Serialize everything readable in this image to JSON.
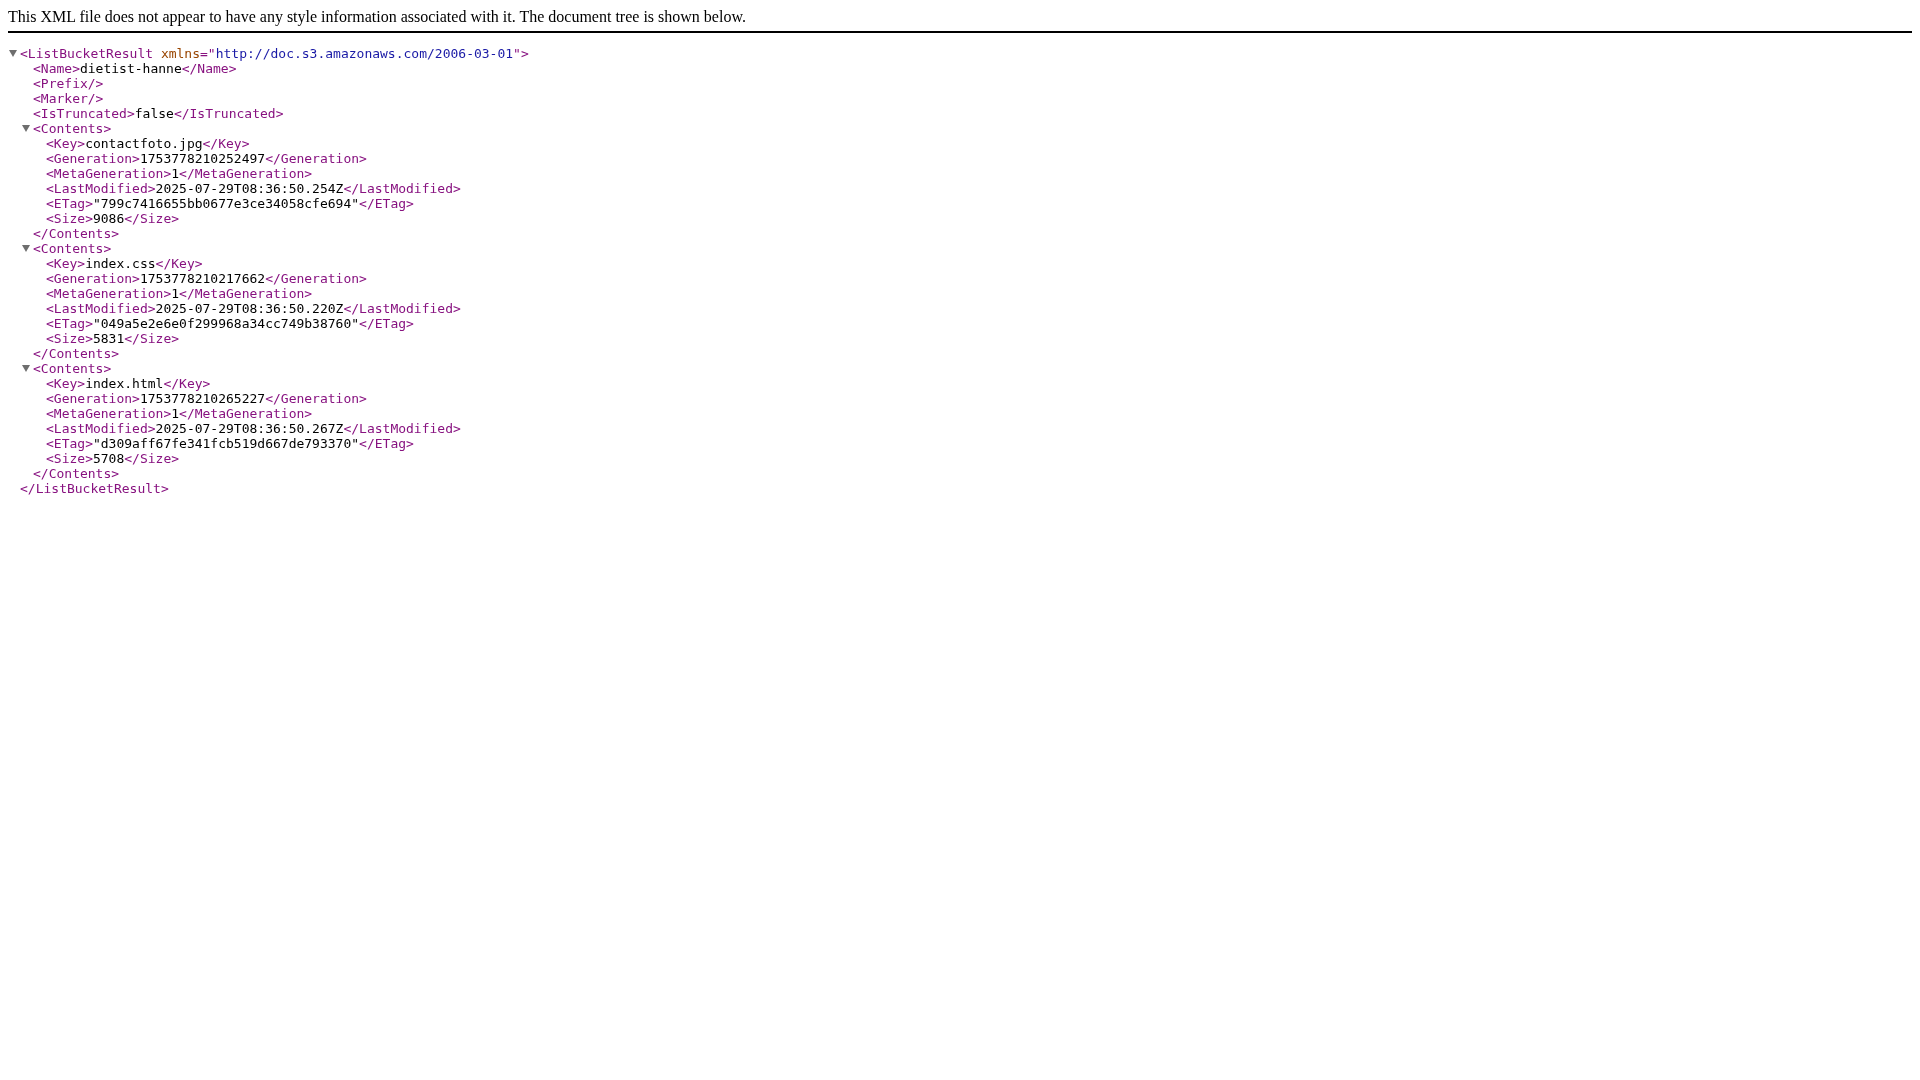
{
  "notice": "This XML file does not appear to have any style information associated with it. The document tree is shown below.",
  "root": {
    "expanded": true,
    "open": "<ListBucketResult",
    "attributes": [
      {
        "name": "xmlns",
        "equals": "=\"",
        "value": "http://doc.s3.amazonaws.com/2006-03-01",
        "quote": "\""
      }
    ],
    "open_end": ">",
    "close": "</ListBucketResult>",
    "children": [
      {
        "open": "<Name>",
        "text": "dietist-hanne",
        "close": "</Name>"
      },
      {
        "open": "<Prefix/>"
      },
      {
        "open": "<Marker/>"
      },
      {
        "open": "<IsTruncated>",
        "text": "false",
        "close": "</IsTruncated>"
      },
      {
        "expanded": true,
        "open": "<Contents>",
        "close": "</Contents>",
        "children": [
          {
            "open": "<Key>",
            "text": "contactfoto.jpg",
            "close": "</Key>"
          },
          {
            "open": "<Generation>",
            "text": "1753778210252497",
            "close": "</Generation>"
          },
          {
            "open": "<MetaGeneration>",
            "text": "1",
            "close": "</MetaGeneration>"
          },
          {
            "open": "<LastModified>",
            "text": "2025-07-29T08:36:50.254Z",
            "close": "</LastModified>"
          },
          {
            "open": "<ETag>",
            "text": "\"799c7416655bb0677e3ce34058cfe694\"",
            "close": "</ETag>"
          },
          {
            "open": "<Size>",
            "text": "9086",
            "close": "</Size>"
          }
        ]
      },
      {
        "expanded": true,
        "open": "<Contents>",
        "close": "</Contents>",
        "children": [
          {
            "open": "<Key>",
            "text": "index.css",
            "close": "</Key>"
          },
          {
            "open": "<Generation>",
            "text": "1753778210217662",
            "close": "</Generation>"
          },
          {
            "open": "<MetaGeneration>",
            "text": "1",
            "close": "</MetaGeneration>"
          },
          {
            "open": "<LastModified>",
            "text": "2025-07-29T08:36:50.220Z",
            "close": "</LastModified>"
          },
          {
            "open": "<ETag>",
            "text": "\"049a5e2e6e0f299968a34cc749b38760\"",
            "close": "</ETag>"
          },
          {
            "open": "<Size>",
            "text": "5831",
            "close": "</Size>"
          }
        ]
      },
      {
        "expanded": true,
        "open": "<Contents>",
        "close": "</Contents>",
        "children": [
          {
            "open": "<Key>",
            "text": "index.html",
            "close": "</Key>"
          },
          {
            "open": "<Generation>",
            "text": "1753778210265227",
            "close": "</Generation>"
          },
          {
            "open": "<MetaGeneration>",
            "text": "1",
            "close": "</MetaGeneration>"
          },
          {
            "open": "<LastModified>",
            "text": "2025-07-29T08:36:50.267Z",
            "close": "</LastModified>"
          },
          {
            "open": "<ETag>",
            "text": "\"d309aff67fe341fcb519d667de793370\"",
            "close": "</ETag>"
          },
          {
            "open": "<Size>",
            "text": "5708",
            "close": "</Size>"
          }
        ]
      }
    ]
  }
}
